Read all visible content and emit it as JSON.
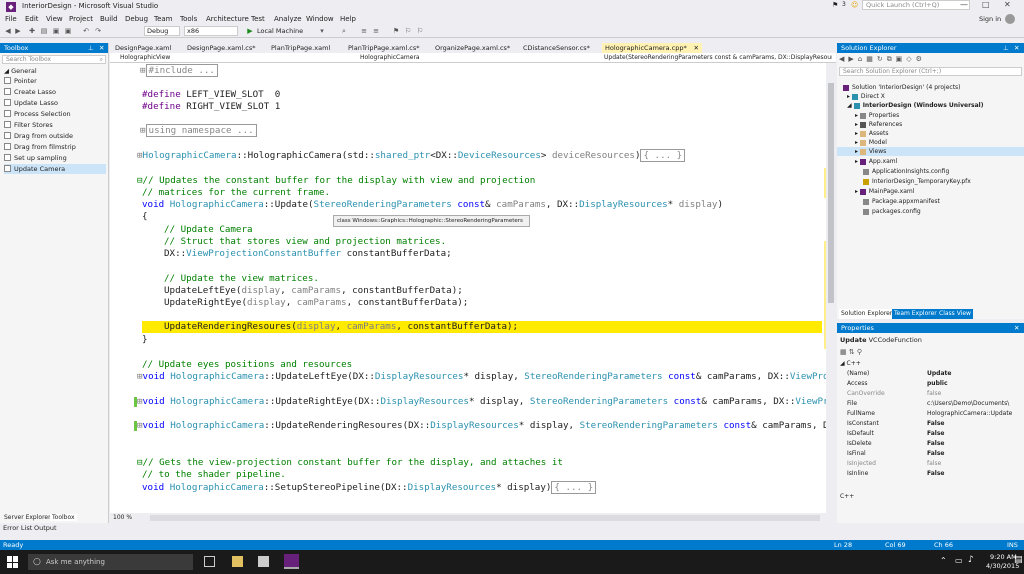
{
  "window": {
    "title": "InteriorDesign - Microsoft Visual Studio",
    "quick_launch_placeholder": "Quick Launch (Ctrl+Q)",
    "sign_in": "Sign in",
    "notif_count": "3"
  },
  "menu": [
    "File",
    "Edit",
    "View",
    "Project",
    "Build",
    "Debug",
    "Team",
    "Tools",
    "Architecture",
    "Test",
    "Analyze",
    "Window",
    "Help"
  ],
  "toolbar": {
    "config": "Debug",
    "platform": "x86",
    "run_label": "Local Machine"
  },
  "toolbox": {
    "title": "Toolbox",
    "search_placeholder": "Search Toolbox",
    "group": "General",
    "items": [
      "Pointer",
      "Create Lasso",
      "Update Lasso",
      "Process Selection",
      "Filter Stores",
      "Drag from outside",
      "Drag from filmstrip",
      "Set up sampling",
      "Update Camera"
    ],
    "bottom_tabs": [
      "Server Explorer",
      "Toolbox"
    ]
  },
  "editor": {
    "tabs": [
      "DesignPage.xaml",
      "DesignPage.xaml.cs*",
      "PlanTripPage.xaml",
      "PlanTripPage.xaml.cs*",
      "OrganizePage.xaml.cs*",
      "CDistanceSensor.cs*",
      "HolographicCamera.cpp*"
    ],
    "nav": [
      "HolographicView",
      "HolographicCamera",
      "Update(StereoRenderingParameters const & camParams, DX::DisplayResource"
    ],
    "tooltip": "class Windows::Graphics::Holographic::StereoRenderingParameters",
    "zoom": "100 %",
    "collapsed_include": "#include ...",
    "collapsed_using": "using namespace ...",
    "collapsed_body": "{ ... }"
  },
  "solution_explorer": {
    "title": "Solution Explorer",
    "search_placeholder": "Search Solution Explorer (Ctrl+;)",
    "items": [
      "Solution 'InteriorDesign' (4 projects)",
      "Direct X",
      "InteriorDesign (Windows Universal)",
      "Properties",
      "References",
      "Assets",
      "Model",
      "Views",
      "App.xaml",
      "ApplicationInsights.config",
      "InteriorDesign_TemporaryKey.pfx",
      "MainPage.xaml",
      "Package.appxmanifest",
      "packages.config"
    ],
    "tabs": [
      "Solution Explorer",
      "Team Explorer",
      "Class View"
    ]
  },
  "properties": {
    "title": "Properties",
    "object": "Update",
    "object_type": "VCCodeFunction",
    "category": "C++",
    "rows": [
      {
        "k": "(Name)",
        "v": "Update"
      },
      {
        "k": "Access",
        "v": "public"
      },
      {
        "k": "CanOverride",
        "v": "false"
      },
      {
        "k": "File",
        "v": "c:\\Users\\Demo\\Documents\\"
      },
      {
        "k": "FullName",
        "v": "HolographicCamera::Update"
      },
      {
        "k": "IsConstant",
        "v": "False"
      },
      {
        "k": "IsDefault",
        "v": "False"
      },
      {
        "k": "IsDelete",
        "v": "False"
      },
      {
        "k": "IsFinal",
        "v": "False"
      },
      {
        "k": "IsInjected",
        "v": "false"
      },
      {
        "k": "IsInline",
        "v": "False"
      }
    ],
    "footer": "C++"
  },
  "bottom_tabs": [
    "Error List",
    "Output"
  ],
  "status": {
    "ready": "Ready",
    "ln": "Ln 28",
    "col": "Col 69",
    "ch": "Ch 66",
    "mode": "INS"
  },
  "taskbar": {
    "search_placeholder": "Ask me anything",
    "time": "9:20 AM",
    "date": "4/30/2015"
  }
}
